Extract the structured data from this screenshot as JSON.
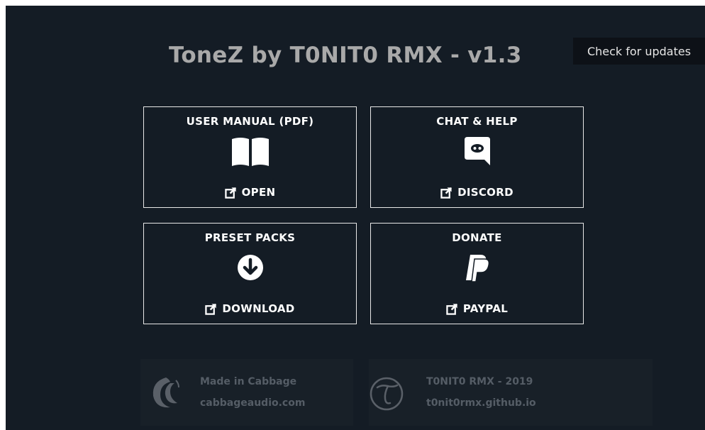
{
  "app": {
    "title": "ToneZ by T0NIT0 RMX - v1.3",
    "update_button": "Check for updates"
  },
  "cards": [
    {
      "title": "USER MANUAL (PDF)",
      "action": "OPEN",
      "icon": "book-icon"
    },
    {
      "title": "CHAT & HELP",
      "action": "DISCORD",
      "icon": "discord-icon"
    },
    {
      "title": "PRESET PACKS",
      "action": "DOWNLOAD",
      "icon": "download-icon"
    },
    {
      "title": "DONATE",
      "action": "PAYPAL",
      "icon": "paypal-icon"
    }
  ],
  "footer": {
    "cabbage": {
      "line1": "Made in Cabbage",
      "line2": "cabbageaudio.com",
      "icon": "cabbage-logo-icon"
    },
    "author": {
      "line1": "T0NIT0 RMX - 2019",
      "line2": "t0nit0rmx.github.io",
      "icon": "tonito-logo-icon"
    }
  },
  "colors": {
    "background": "#141c25",
    "title": "#a9a9a9",
    "card_border": "#e8e8e8",
    "footer_text": "#555d66"
  }
}
